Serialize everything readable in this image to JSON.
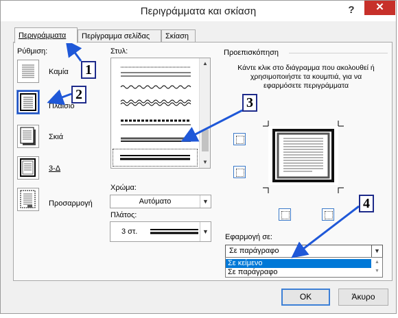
{
  "window": {
    "title": "Περιγράμματα και σκίαση",
    "help": "?",
    "close": "✕"
  },
  "tabs": [
    {
      "label": "Περιγράμματα",
      "active": true
    },
    {
      "label": "Περίγραμμα σελίδας",
      "active": false
    },
    {
      "label": "Σκίαση",
      "active": false
    }
  ],
  "setting": {
    "label": "Ρύθμιση:",
    "options": [
      {
        "label": "Καμία",
        "icon": "setting-none-icon"
      },
      {
        "label": "Πλαίσιο",
        "icon": "setting-box-icon",
        "selected": true
      },
      {
        "label": "Σκιά",
        "icon": "setting-shadow-icon"
      },
      {
        "label": "3-Δ",
        "icon": "setting-3d-icon"
      },
      {
        "label": "Προσαρμογή",
        "icon": "setting-custom-icon"
      }
    ]
  },
  "style": {
    "label": "Στυλ:"
  },
  "color": {
    "label": "Χρώμα:",
    "value": "Αυτόματο"
  },
  "width": {
    "label": "Πλάτος:",
    "value": "3 στ."
  },
  "preview": {
    "label": "Προεπισκόπηση",
    "instructions": "Κάντε κλικ στο διάγραμμα που ακολουθεί ή χρησιμοποιήστε τα κουμπιά, για να εφαρμόσετε περιγράμματα"
  },
  "apply_to": {
    "label": "Εφαρμογή σε:",
    "value": "Σε παράγραφο",
    "options": [
      "Σε κείμενο",
      "Σε παράγραφο"
    ],
    "highlighted": "Σε κείμενο"
  },
  "buttons": {
    "ok": "ΟΚ",
    "cancel": "Άκυρο"
  },
  "callouts": [
    "1",
    "2",
    "3",
    "4"
  ],
  "colors": {
    "callout_border": "#1d2a8a",
    "arrow": "#1f58d8",
    "highlight": "#0078d7",
    "close": "#c7302a"
  }
}
